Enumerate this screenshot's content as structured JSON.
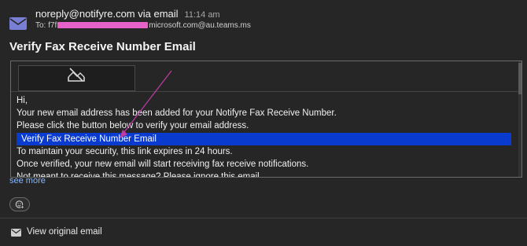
{
  "email": {
    "sender": "noreply@notifyre.com via email",
    "time": "11:14 am",
    "to_prefix": "To: f7f",
    "to_suffix": "microsoft.com@au.teams.ms",
    "subject": "Verify Fax Receive Number Email"
  },
  "body": {
    "greeting": "Hi,",
    "line1": "Your new email address has been added for your Notifyre Fax Receive Number.",
    "line2": "Please click the button below to verify your email address.",
    "verify_link": "Verify Fax Receive Number Email",
    "line3": "To maintain your security, this link expires in 24 hours.",
    "line4": "Once verified, your new email will start receiving fax receive notifications.",
    "line5": "Not meant to receive this message? Please ignore this email."
  },
  "footer": {
    "see_more": "see more",
    "view_original": "View original email"
  },
  "colors": {
    "background": "#262626",
    "link_highlight": "#0a3bcf",
    "annotation_arrow": "#c23aa8",
    "redaction": "#e661c8",
    "see_more": "#8ab4f8"
  },
  "icons": {
    "sender": "mail-icon",
    "logo": "broken-image-icon",
    "reaction": "add-reaction-icon",
    "view_original": "mail-icon"
  }
}
